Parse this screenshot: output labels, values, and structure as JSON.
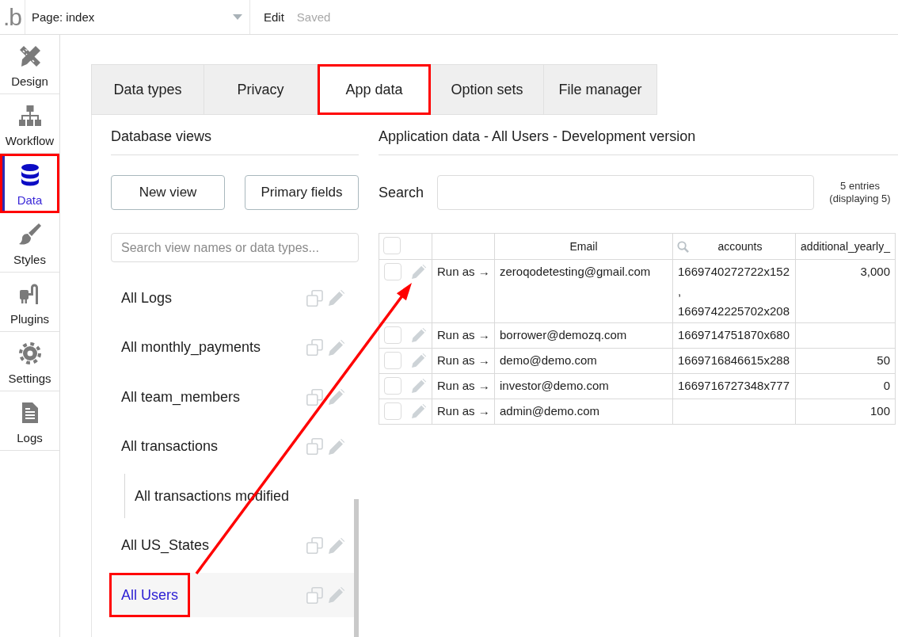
{
  "top_bar": {
    "logo": ".b",
    "page_select": "Page: index",
    "edit": "Edit",
    "save_status": "Saved"
  },
  "sidebar": {
    "items": [
      {
        "label": "Design",
        "selected": false,
        "highlighted": false
      },
      {
        "label": "Workflow",
        "selected": false,
        "highlighted": false
      },
      {
        "label": "Data",
        "selected": true,
        "highlighted": true
      },
      {
        "label": "Styles",
        "selected": false,
        "highlighted": false
      },
      {
        "label": "Plugins",
        "selected": false,
        "highlighted": false
      },
      {
        "label": "Settings",
        "selected": false,
        "highlighted": false
      },
      {
        "label": "Logs",
        "selected": false,
        "highlighted": false
      }
    ]
  },
  "tabs": [
    {
      "label": "Data types",
      "selected": false,
      "highlighted": false
    },
    {
      "label": "Privacy",
      "selected": false,
      "highlighted": false
    },
    {
      "label": "App data",
      "selected": true,
      "highlighted": true
    },
    {
      "label": "Option sets",
      "selected": false,
      "highlighted": false
    },
    {
      "label": "File manager",
      "selected": false,
      "highlighted": false
    }
  ],
  "database_views": {
    "title": "Database views",
    "buttons": [
      "New view",
      "Primary fields"
    ],
    "search": {
      "placeholder": "Search view names or data types..."
    },
    "views": [
      {
        "name": "All Logs",
        "selected": false,
        "highlighted": false
      },
      {
        "name": "All monthly_payments",
        "selected": false,
        "highlighted": false
      },
      {
        "name": "All team_members",
        "selected": false,
        "highlighted": false
      },
      {
        "name": "All transactions",
        "selected": false,
        "highlighted": false,
        "children": [
          {
            "name": "All transactions modified",
            "selected": false,
            "highlighted": false
          }
        ]
      },
      {
        "name": "All US_States",
        "selected": false,
        "highlighted": false
      },
      {
        "name": "All Users",
        "selected": true,
        "highlighted": true
      }
    ]
  },
  "app_data": {
    "title": "Application data - All Users - Development version",
    "search": {
      "label": "Search"
    },
    "entries": "5 entries (displaying 5)",
    "table": {
      "columns": [
        {
          "kind": "checkbox",
          "checked": false
        },
        {
          "kind": "blank"
        },
        {
          "kind": "label",
          "label": "Email"
        },
        {
          "kind": "searchable",
          "label": "accounts"
        },
        {
          "kind": "label",
          "label": "additional_yearly_"
        }
      ],
      "rows": [
        {
          "checked": false,
          "run_as": "Run as →",
          "email": "zeroqodetesting@gmail.com",
          "accounts": [
            "1669740272722x152",
            ",",
            "1669742225702x208"
          ],
          "additional_yearly": "3,000"
        },
        {
          "checked": false,
          "run_as": "Run as →",
          "email": "borrower@demozq.com",
          "accounts": [
            "1669714751870x680"
          ]
        },
        {
          "checked": false,
          "run_as": "Run as →",
          "email": "demo@demo.com",
          "accounts": [
            "1669716846615x288"
          ],
          "additional_yearly": "50"
        },
        {
          "checked": false,
          "run_as": "Run as →",
          "email": "investor@demo.com",
          "accounts": [
            "1669716727348x777"
          ],
          "additional_yearly": "0"
        },
        {
          "checked": false,
          "run_as": "Run as →",
          "email": "admin@demo.com",
          "additional_yearly": "100"
        }
      ]
    }
  }
}
